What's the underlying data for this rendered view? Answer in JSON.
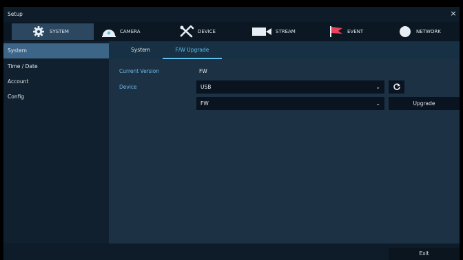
{
  "window": {
    "title": "Setup",
    "close_glyph": "×"
  },
  "tabs": [
    {
      "label": "SYSTEM",
      "icon": "gear-icon"
    },
    {
      "label": "CAMERA",
      "icon": "dome-camera-icon"
    },
    {
      "label": "DEVICE",
      "icon": "tools-icon"
    },
    {
      "label": "STREAM",
      "icon": "video-camera-icon"
    },
    {
      "label": "EVENT",
      "icon": "flag-icon"
    },
    {
      "label": "NETWORK",
      "icon": "globe-icon"
    }
  ],
  "sidebar": {
    "items": [
      {
        "label": "System"
      },
      {
        "label": "Time / Date"
      },
      {
        "label": "Account"
      },
      {
        "label": "Config"
      }
    ]
  },
  "subtabs": [
    {
      "label": "System"
    },
    {
      "label": "F/W Upgrade"
    }
  ],
  "form": {
    "current_version_label": "Current Version",
    "current_version_value": "FW",
    "device_label": "Device",
    "device_select_value": "USB",
    "file_select_value": "FW",
    "upgrade_label": "Upgrade"
  },
  "footer": {
    "exit_label": "Exit"
  },
  "colors": {
    "accent": "#5bc2ee",
    "label_blue": "#6fb8e6",
    "active_sidebar": "#3d6587",
    "active_tab": "#2c4860"
  }
}
